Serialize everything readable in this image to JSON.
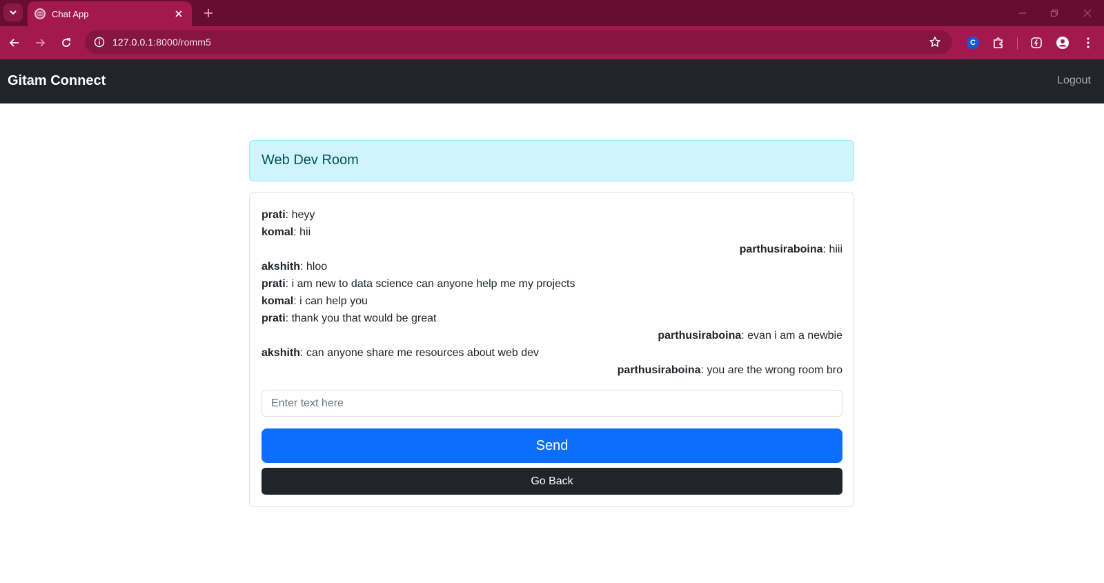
{
  "browser": {
    "tab_title": "Chat App",
    "url_host": "127.0.0.1",
    "url_rest": ":8000/romm5",
    "icons": {
      "tab_search": "chevron-down-icon",
      "favicon": "globe-icon",
      "tab_close": "close-icon",
      "new_tab": "plus-icon",
      "back": "arrow-left-icon",
      "forward": "arrow-right-icon",
      "reload": "reload-icon",
      "site_info": "info-icon",
      "bookmark": "star-icon",
      "extension_c": "c-extension-icon",
      "extensions": "puzzle-icon",
      "performance": "performance-icon",
      "profile": "profile-icon",
      "menu": "more-vertical-icon"
    },
    "extension_c_label": "C"
  },
  "navbar": {
    "brand": "Gitam Connect",
    "logout_label": "Logout"
  },
  "room": {
    "title": "Web Dev Room"
  },
  "messages": [
    {
      "sender": "prati",
      "text": ": heyy",
      "align": "left"
    },
    {
      "sender": "komal",
      "text": ": hii",
      "align": "left"
    },
    {
      "sender": "parthusiraboina",
      "text": ": hiii",
      "align": "right"
    },
    {
      "sender": "akshith",
      "text": ": hloo",
      "align": "left"
    },
    {
      "sender": "prati",
      "text": ": i am new to data science can anyone help me my projects",
      "align": "left"
    },
    {
      "sender": "komal",
      "text": ": i can help you",
      "align": "left"
    },
    {
      "sender": "prati",
      "text": ": thank you that would be great",
      "align": "left"
    },
    {
      "sender": "parthusiraboina",
      "text": ": evan i am a newbie",
      "align": "right"
    },
    {
      "sender": "akshith",
      "text": ": can anyone share me resources about web dev",
      "align": "left"
    },
    {
      "sender": "parthusiraboina",
      "text": ": you are the wrong room bro",
      "align": "right"
    }
  ],
  "composer": {
    "placeholder": "Enter text here",
    "value": "",
    "send_label": "Send",
    "back_label": "Go Back"
  },
  "colors": {
    "tabstrip": "#690c33",
    "toolbar": "#a3184f",
    "navbar": "#212529",
    "room_header_bg": "#cff4fc",
    "room_header_text": "#055160",
    "send_button": "#0d6efd",
    "back_button": "#212529"
  }
}
